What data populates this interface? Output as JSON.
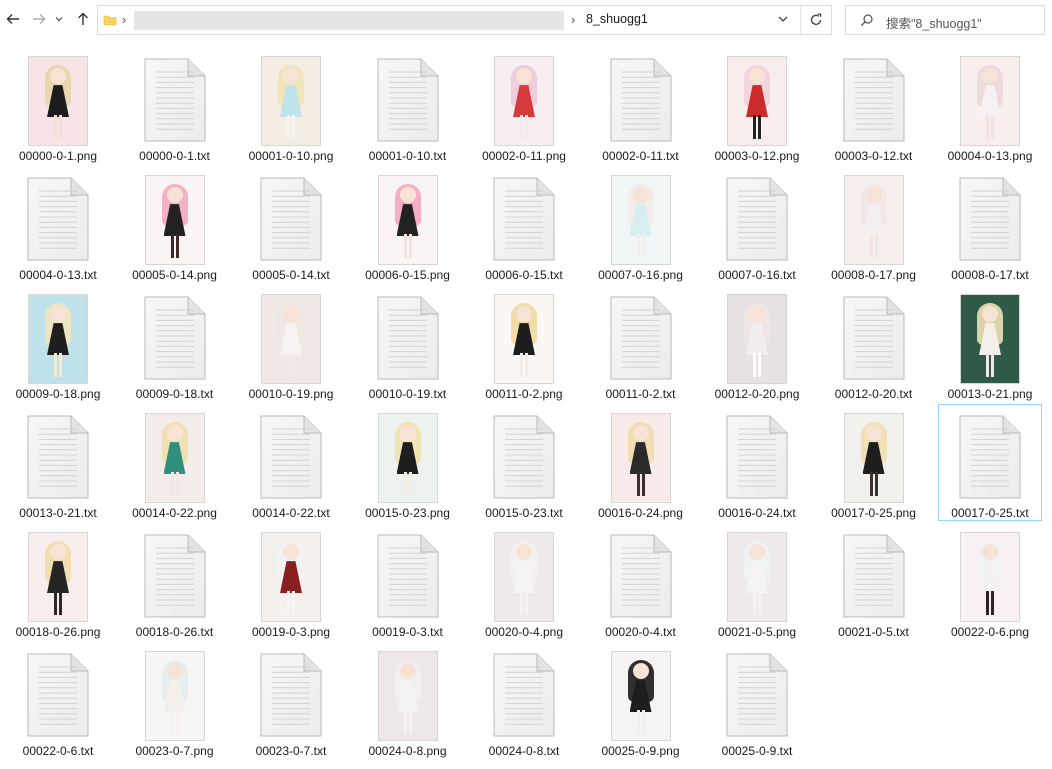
{
  "toolbar": {
    "breadcrumb_current": "8_shuogg1",
    "search_placeholder": "搜索\"8_shuogg1\""
  },
  "files": [
    {
      "name": "00000-0-1.png",
      "type": "image",
      "bg": "#f6e4e6",
      "dress": "#1c1c1c",
      "hair": "#e8d6a8",
      "legs": "#f0e0d8"
    },
    {
      "name": "00000-0-1.txt",
      "type": "text"
    },
    {
      "name": "00001-0-10.png",
      "type": "image",
      "bg": "#f3ede4",
      "dress": "#bfe3ea",
      "hair": "#efe2b4",
      "legs": "#f4f4f4"
    },
    {
      "name": "00001-0-10.txt",
      "type": "text"
    },
    {
      "name": "00002-0-11.png",
      "type": "image",
      "bg": "#f6eef0",
      "dress": "#d63a3a",
      "hair": "#f1c9d8",
      "legs": "#f4e8e8"
    },
    {
      "name": "00002-0-11.txt",
      "type": "text"
    },
    {
      "name": "00003-0-12.png",
      "type": "image",
      "bg": "#f7eded",
      "dress": "#cc2b2b",
      "hair": "#f2d0da",
      "legs": "#222222"
    },
    {
      "name": "00003-0-12.txt",
      "type": "text"
    },
    {
      "name": "00004-0-13.png",
      "type": "image",
      "bg": "#f8eeee",
      "dress": "#f7f0f2",
      "hair": "#ead7da",
      "legs": "#f3e2e2"
    },
    {
      "name": "00004-0-13.txt",
      "type": "text"
    },
    {
      "name": "00005-0-14.png",
      "type": "image",
      "bg": "#faf4f4",
      "dress": "#222222",
      "hair": "#f4a9c0",
      "legs": "#3a2a2a"
    },
    {
      "name": "00005-0-14.txt",
      "type": "text"
    },
    {
      "name": "00006-0-15.png",
      "type": "image",
      "bg": "#faf4f4",
      "dress": "#222222",
      "hair": "#f3a7bf",
      "legs": "#f2e0e0"
    },
    {
      "name": "00006-0-15.txt",
      "type": "text"
    },
    {
      "name": "00007-0-16.png",
      "type": "image",
      "bg": "#f3f6f6",
      "dress": "#d7eef0",
      "hair": "#f2ecea",
      "legs": "#f4f0f0"
    },
    {
      "name": "00007-0-16.txt",
      "type": "text"
    },
    {
      "name": "00008-0-17.png",
      "type": "image",
      "bg": "#f7eeee",
      "dress": "#f5eef0",
      "hair": "#efe6e4",
      "legs": "#f2e4e4"
    },
    {
      "name": "00008-0-17.txt",
      "type": "text"
    },
    {
      "name": "00009-0-18.png",
      "type": "image",
      "bg": "#bfe2ea",
      "dress": "#1e1e1e",
      "hair": "#f1e6c0",
      "legs": "#f2ecd0"
    },
    {
      "name": "00009-0-18.txt",
      "type": "text"
    },
    {
      "name": "00010-0-19.png",
      "type": "image",
      "bg": "#efe8e4",
      "dress": "#f7f3f2",
      "hair": "#eee7e0",
      "legs": "#f2eae6"
    },
    {
      "name": "00010-0-19.txt",
      "type": "text"
    },
    {
      "name": "00011-0-2.png",
      "type": "image",
      "bg": "#faf7f4",
      "dress": "#1c1c1c",
      "hair": "#f0d9a0",
      "legs": "#f5ece6"
    },
    {
      "name": "00011-0-2.txt",
      "type": "text"
    },
    {
      "name": "00012-0-20.png",
      "type": "image",
      "bg": "#e6e2e2",
      "dress": "#f3eeee",
      "hair": "#f1e6e6",
      "legs": "#ffffff"
    },
    {
      "name": "00012-0-20.txt",
      "type": "text"
    },
    {
      "name": "00013-0-21.png",
      "type": "image",
      "bg": "#2f5a48",
      "dress": "#f3efe9",
      "hair": "#efe0b6",
      "legs": "#f1e6e0"
    },
    {
      "name": "00013-0-21.txt",
      "type": "text"
    },
    {
      "name": "00014-0-22.png",
      "type": "image",
      "bg": "#f4ecea",
      "dress": "#2f8f7c",
      "hair": "#f0dfae",
      "legs": "#f3e8e4"
    },
    {
      "name": "00014-0-22.txt",
      "type": "text"
    },
    {
      "name": "00015-0-23.png",
      "type": "image",
      "bg": "#eef2ee",
      "dress": "#1e1e1e",
      "hair": "#f1e2b0",
      "legs": "#f2ece6"
    },
    {
      "name": "00015-0-23.txt",
      "type": "text"
    },
    {
      "name": "00016-0-24.png",
      "type": "image",
      "bg": "#f9eaea",
      "dress": "#2a2a2a",
      "hair": "#efdcab",
      "legs": "#3a2e2e"
    },
    {
      "name": "00016-0-24.txt",
      "type": "text"
    },
    {
      "name": "00017-0-25.png",
      "type": "image",
      "bg": "#f3f1ee",
      "dress": "#1e1e1e",
      "hair": "#efdfb0",
      "legs": "#3a3030"
    },
    {
      "name": "00017-0-25.txt",
      "type": "text",
      "selected": true
    },
    {
      "name": "00018-0-26.png",
      "type": "image",
      "bg": "#f8eeee",
      "dress": "#252525",
      "hair": "#efdcaa",
      "legs": "#2f2828"
    },
    {
      "name": "00018-0-26.txt",
      "type": "text"
    },
    {
      "name": "00019-0-3.png",
      "type": "image",
      "bg": "#f4f0ee",
      "dress": "#8a1f1f",
      "hair": "#f2f2f2",
      "legs": "#f6f6f6"
    },
    {
      "name": "00019-0-3.txt",
      "type": "text"
    },
    {
      "name": "00020-0-4.png",
      "type": "image",
      "bg": "#eeeaea",
      "dress": "#f5f3f3",
      "hair": "#f3f1f1",
      "legs": "#f6f2f2"
    },
    {
      "name": "00020-0-4.txt",
      "type": "text"
    },
    {
      "name": "00021-0-5.png",
      "type": "image",
      "bg": "#eeeaea",
      "dress": "#f5f3f3",
      "hair": "#eef3f4",
      "legs": "#f6f2f2"
    },
    {
      "name": "00021-0-5.txt",
      "type": "text"
    },
    {
      "name": "00022-0-6.png",
      "type": "image",
      "bg": "#f8f0f2",
      "dress": "#f2f0f0",
      "hair": "#eef2f4",
      "legs": "#2a2424"
    },
    {
      "name": "00022-0-6.txt",
      "type": "text"
    },
    {
      "name": "00023-0-7.png",
      "type": "image",
      "bg": "#f6f6f4",
      "dress": "#f3f0ee",
      "hair": "#e4eef0",
      "legs": "#f6f2f0"
    },
    {
      "name": "00023-0-7.txt",
      "type": "text"
    },
    {
      "name": "00024-0-8.png",
      "type": "image",
      "bg": "#eee8ea",
      "dress": "#f4f1f1",
      "hair": "#f2f0f2",
      "legs": "#f5f1f1"
    },
    {
      "name": "00024-0-8.txt",
      "type": "text"
    },
    {
      "name": "00025-0-9.png",
      "type": "image",
      "bg": "#f6f3f4",
      "dress": "#1e1e1e",
      "hair": "#1a1a1a",
      "legs": "#f2eeee"
    },
    {
      "name": "00025-0-9.txt",
      "type": "text"
    }
  ]
}
